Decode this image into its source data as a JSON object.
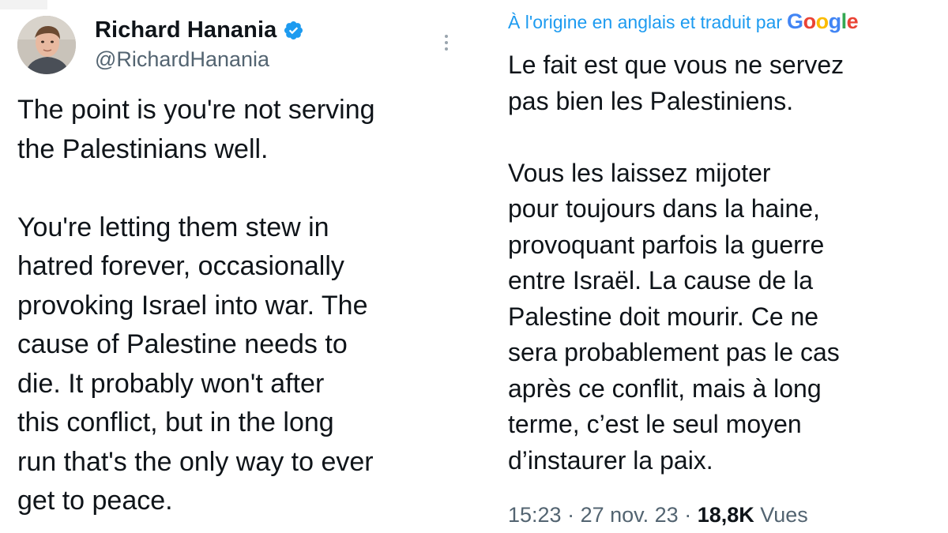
{
  "tweet": {
    "display_name": "Richard Hanania",
    "handle": "@RichardHanania",
    "text_lines": "The point is you're not serving\nthe Palestinians well.\n\nYou're letting them stew in\nhatred forever, occasionally\nprovoking Israel into war. The\ncause of Palestine needs to\ndie. It probably won't after\nthis conflict, but in the long\nrun that's the only way to ever\nget to peace.",
    "verified_icon": "verified-badge-icon",
    "more_icon": "more-vertical-icon"
  },
  "translation": {
    "label": "À l'origine en anglais et traduit par",
    "provider": "Google",
    "text_lines": "Le fait est que vous ne servez\npas bien les Palestiniens.\n\nVous les laissez mijoter\npour toujours dans la haine,\nprovoquant parfois la guerre\nentre Israël. La cause de la\nPalestine doit mourir. Ce ne\nsera probablement pas le cas\naprès ce conflit, mais à long\nterme, c’est le seul moyen\nd’instaurer la paix."
  },
  "meta": {
    "time": "15:23",
    "sep1": " · ",
    "date": "27 nov. 23",
    "sep2": " · ",
    "views_count": "18,8K",
    "views_label": " Vues"
  },
  "colors": {
    "accent": "#1d9bf0",
    "text": "#0f1419",
    "muted": "#536471"
  }
}
